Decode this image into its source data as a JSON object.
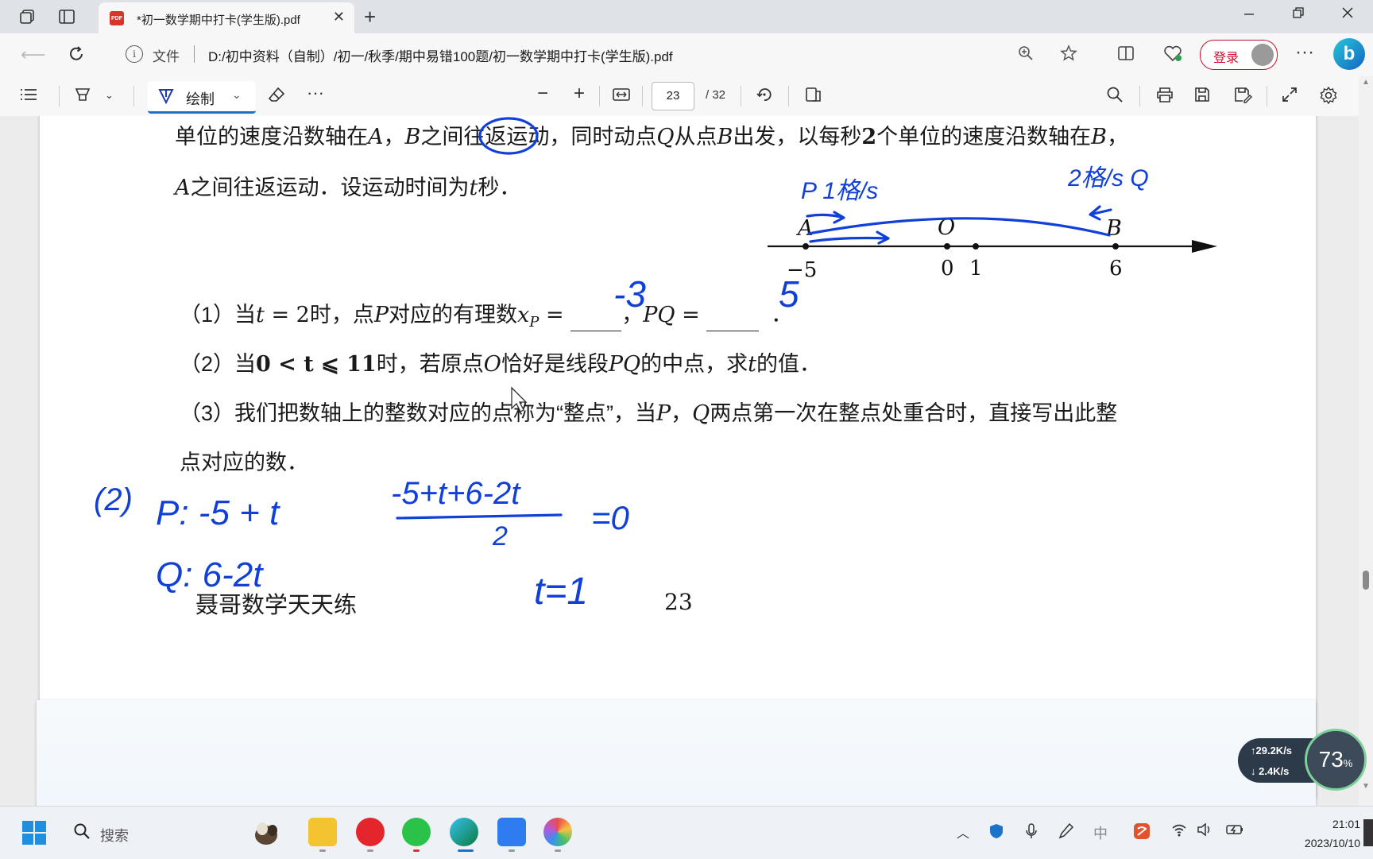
{
  "tabstrip": {
    "tab_title": "*初一数学期中打卡(学生版).pdf",
    "pdf_badge": "PDF",
    "new_tab": "+",
    "close": "✕"
  },
  "address": {
    "file_label": "文件",
    "url": "D:/初中资料（自制）/初一/秋季/期中易错100题/初一数学期中打卡(学生版).pdf",
    "login_label": "登录"
  },
  "pdf_toolbar": {
    "draw_label": "绘制",
    "page_current": "23",
    "page_total": "/ 32",
    "zoom_out": "−",
    "zoom_in": "+",
    "more": "···"
  },
  "document": {
    "line1_a": "单位的速度沿数轴在",
    "line1_A": "A",
    "line1_sep": "，",
    "line1_B": "B",
    "line1_b": "之间往返运动，同时动点",
    "line1_Q": "Q",
    "line1_c": "从点",
    "line1_B2": "B",
    "line1_d": "出发，以每秒",
    "line1_two": "2",
    "line1_e": "个单位的速度沿数轴在",
    "line1_B3": "B",
    "line1_f": "，",
    "line2_A": "A",
    "line2_a": "之间往返运动．设运动时间为",
    "line2_t": "t",
    "line2_b": "秒．",
    "numline": {
      "label_A": "A",
      "label_O": "O",
      "label_B": "B",
      "tick_m5": "−5",
      "tick_0": "0",
      "tick_1": "1",
      "tick_6": "6"
    },
    "q1": {
      "prefix": "（1）当",
      "t": "t",
      "eq": " = 2",
      "mid": "时，点",
      "P": "P",
      "mid2": "对应的有理数",
      "xP": "x",
      "sub": "P",
      "eq2": " = ",
      "comma": "，",
      "PQ": "PQ",
      "eq3": " = ",
      "end": "．"
    },
    "q2": {
      "prefix": "（2）当",
      "cond": "0 < t ⩽ 11",
      "mid": "时，若原点",
      "O": "O",
      "mid2": "恰好是线段",
      "PQ": "PQ",
      "end": "的中点，求",
      "t": "t",
      "end2": "的值．"
    },
    "q3": {
      "line1_a": "（3）我们把数轴上的整数对应的点称为“整点”，当",
      "P": "P",
      "sep": "，",
      "Q": "Q",
      "line1_b": "两点第一次在整点处重合时，直接写出此整",
      "line2": "点对应的数．"
    },
    "footer_left": "聂哥数学天天练",
    "footer_page": "23"
  },
  "handwriting": {
    "speed_p": "P 1格/s",
    "speed_q": "2格/s Q",
    "ans_xp": "-3",
    "ans_pq": "5",
    "label_2": "(2)",
    "p_expr": "P: -5 + t",
    "q_expr": "Q: 6-2t",
    "frac_num": "-5+t+6-2t",
    "frac_den": "2",
    "eq_zero": "=0",
    "t_result": "t=1",
    "ink_color": "#1040d8"
  },
  "netwidget": {
    "up": "↑29.2K/s",
    "down": "↓ 2.4K/s",
    "gauge": "73",
    "gauge_unit": "%"
  },
  "taskbar": {
    "search_placeholder": "搜索",
    "time": "21:01",
    "date": "2023/10/10"
  }
}
